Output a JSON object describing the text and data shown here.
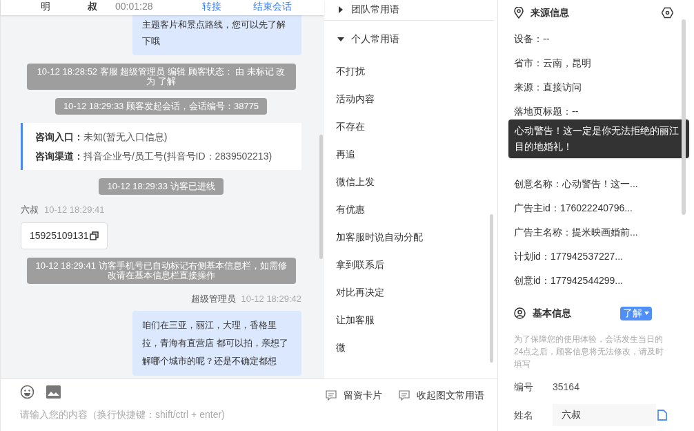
{
  "header": {
    "names": [
      "明",
      "叔"
    ],
    "timer": "00:01:28",
    "actions": [
      "转接",
      "结束会话"
    ]
  },
  "messages": [
    {
      "kind": "agent_bubble",
      "text": "主题客片和景点路线，您可以先了解下哦"
    },
    {
      "kind": "system",
      "text": "10-12 18:28:52 客服 超级管理员 编辑 顾客状态： 由 未标记 改为 了解"
    },
    {
      "kind": "system",
      "text": "10-12 18:29:33 顾客发起会话，会话编号：38775"
    },
    {
      "kind": "info_card",
      "rows": [
        {
          "label": "咨询入口：",
          "value": "未知(暂无入口信息)"
        },
        {
          "label": "咨询渠道：",
          "value": "抖音企业号/员工号(抖音号ID：2839502213)"
        }
      ]
    },
    {
      "kind": "system",
      "text": "10-12 18:29:33 访客已进线"
    },
    {
      "kind": "visitor",
      "sender": "六叔",
      "time": "10-12 18:29:41",
      "text": "15925109131"
    },
    {
      "kind": "system",
      "text": "10-12 18:29:41 访客手机号已自动标记右侧基本信息栏，如需修改请在基本信息栏直接操作"
    },
    {
      "kind": "agent",
      "sender": "超级管理员",
      "time": "10-12 18:29:42",
      "text": "咱们在三亚，丽江，大理，香格里拉，青海有直营店 都可以拍，亲想了解哪个城市的呢？还是不确定都想"
    }
  ],
  "composer": {
    "placeholder": "请输入您的内容（换行快捷键：shift/ctrl + enter)"
  },
  "phrases": {
    "groups": [
      {
        "label": "团队常用语",
        "expanded": false
      },
      {
        "label": "个人常用语",
        "expanded": true,
        "items": [
          "不打扰",
          "活动内容",
          "不存在",
          "再追",
          "微信上发",
          "有优惠",
          "加客服时说自动分配",
          "拿到联系后",
          "对比再决定",
          "让加客服",
          "微"
        ]
      }
    ],
    "actions": [
      "留资卡片",
      "收起图文常用语"
    ]
  },
  "source_info": {
    "title": "来源信息",
    "rows": [
      {
        "kind": "row",
        "text": "设备：--"
      },
      {
        "kind": "row",
        "text": "省市：云南，昆明"
      },
      {
        "kind": "row",
        "text": "来源：直接访问"
      },
      {
        "kind": "row",
        "text": "落地页标题：--"
      },
      {
        "kind": "tooltip",
        "text": "心动警告！这一定是你无法拒绝的丽江目的地婚礼！"
      },
      {
        "kind": "row",
        "text": "创意名称：心动警告！这一..."
      },
      {
        "kind": "row",
        "text": "广告主id：176022240796..."
      },
      {
        "kind": "row",
        "text": "广告主名称：提米映画婚前..."
      },
      {
        "kind": "row",
        "text": "计划id：177942537227..."
      },
      {
        "kind": "row",
        "text": "创意id：177942544299..."
      }
    ]
  },
  "basic_info": {
    "title": "基本信息",
    "status": "了解",
    "notice": "为了保障您的使用体验，会话发生当日的24点之后，顾客信息将无法修改，请及时填写",
    "fields": [
      {
        "kind": "text",
        "label": "编号",
        "value": "35164"
      },
      {
        "kind": "input",
        "label": "姓名",
        "value": "六叔"
      }
    ]
  }
}
